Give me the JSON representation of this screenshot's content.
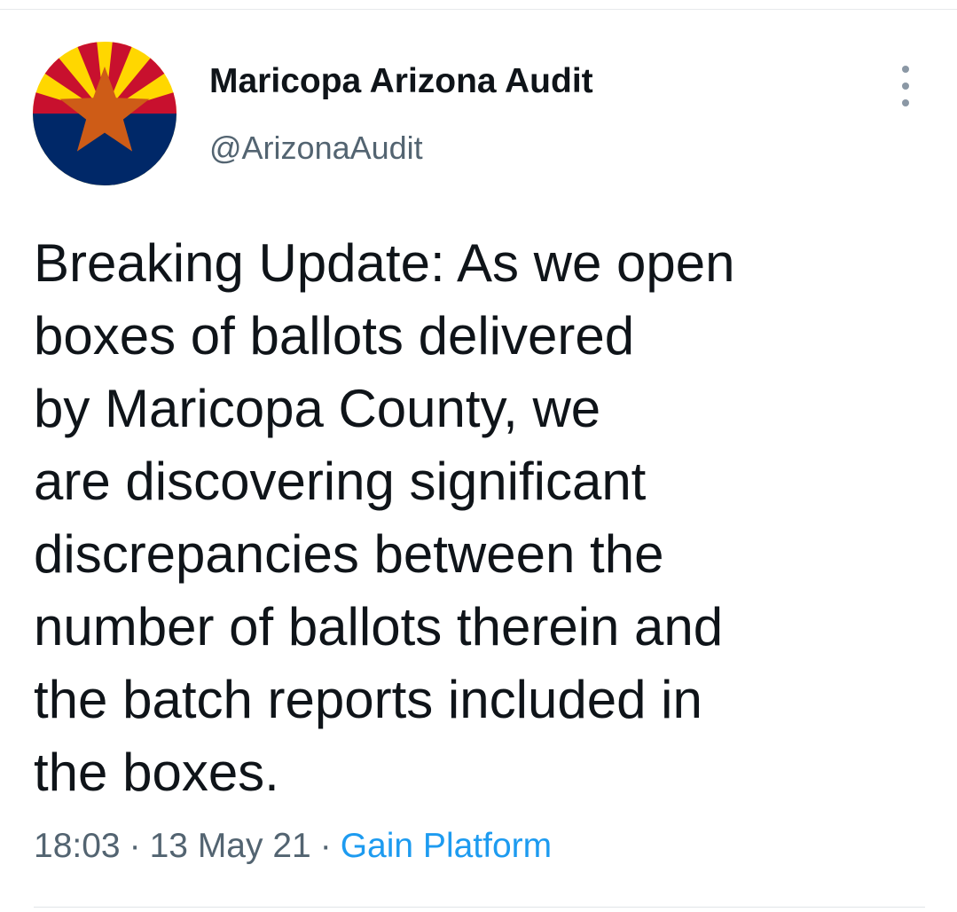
{
  "tweet": {
    "display_name": "Maricopa Arizona Audit",
    "handle": "@ArizonaAudit",
    "more_icon": "more-vertical-icon",
    "avatar_icon": "arizona-flag-icon",
    "text_lines": [
      "Breaking Update: As we open",
      "boxes of ballots delivered",
      "by Maricopa County, we",
      "are discovering significant",
      "discrepancies between the",
      "number of ballots therein and",
      "the batch reports included in",
      "the boxes."
    ],
    "time": "18:03",
    "separator": "·",
    "date": "13 May 21",
    "source": "Gain Platform"
  },
  "colors": {
    "text": "#0f1419",
    "secondary": "#536471",
    "link": "#1d9bf0",
    "flag_red": "#c8102e",
    "flag_yellow": "#ffd700",
    "flag_copper": "#ce5c17",
    "flag_blue": "#002868"
  }
}
